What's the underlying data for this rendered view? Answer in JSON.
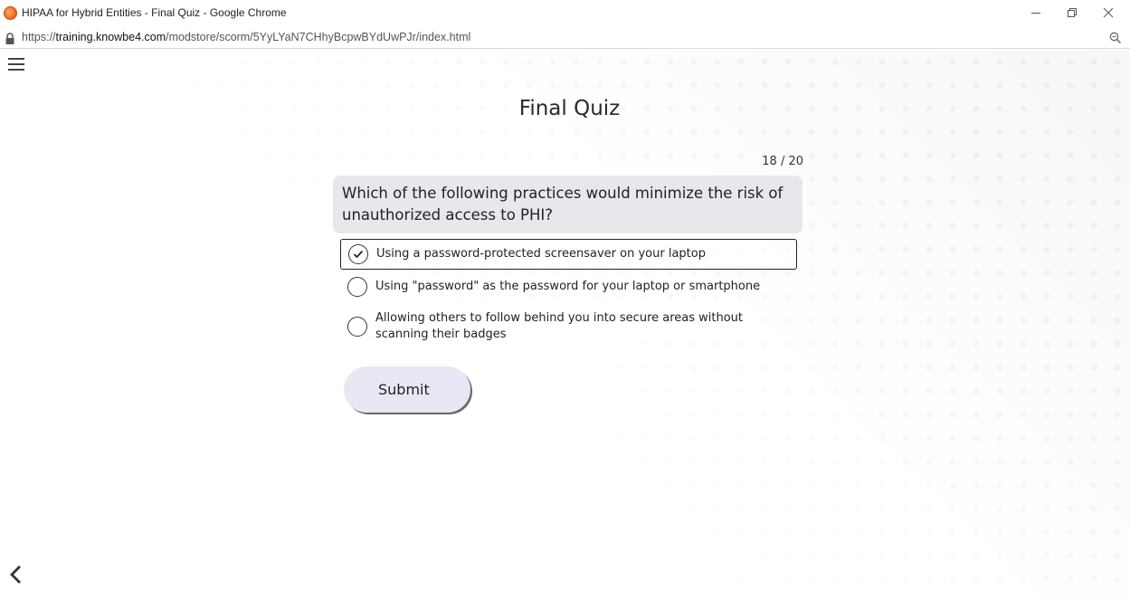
{
  "window": {
    "title": "HIPAA for Hybrid Entities - Final Quiz - Google Chrome",
    "app_icon": "chrome-app-icon",
    "controls": [
      "minimize-icon",
      "restore-icon",
      "close-icon"
    ]
  },
  "address_bar": {
    "scheme": "https://",
    "host": "training.knowbe4.com",
    "path": "/modstore/scorm/5YyLYaN7CHhyBcpwBYdUwPJr/index.html",
    "icons": [
      "lock-icon",
      "zoom-icon"
    ]
  },
  "quiz": {
    "title": "Final Quiz",
    "progress": "18 / 20",
    "question": "Which of the following practices would minimize the risk of unauthorized access to PHI?",
    "options": [
      {
        "label": "Using a password-protected screensaver on your laptop",
        "selected": true
      },
      {
        "label": "Using \"password\" as the password for your laptop or smartphone",
        "selected": false
      },
      {
        "label": "Allowing others to follow behind you into secure areas without scanning their badges",
        "selected": false
      }
    ],
    "submit_label": "Submit"
  },
  "nav": {
    "menu_icon": "hamburger-menu-icon",
    "back_icon": "chevron-left-icon"
  },
  "colors": {
    "question_bg": "#e6e8ec",
    "submit_bg": "#e9e7f4",
    "app_icon": "#f36a24"
  }
}
